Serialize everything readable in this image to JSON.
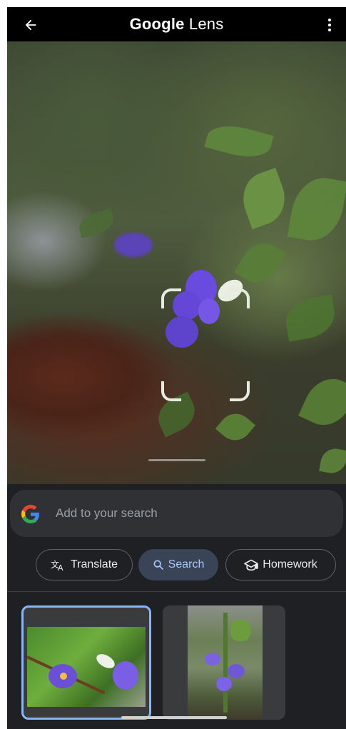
{
  "header": {
    "back_icon": "arrow-left-icon",
    "title_brand": "Google",
    "title_product": "Lens",
    "more_icon": "more-vertical-icon"
  },
  "viewer": {
    "selection": "flower-selection"
  },
  "search": {
    "logo_icon": "google-g-icon",
    "placeholder": "Add to your search"
  },
  "chips": [
    {
      "label": "Translate",
      "icon": "translate-icon",
      "active": false
    },
    {
      "label": "Search",
      "icon": "search-icon",
      "active": true
    },
    {
      "label": "Homework",
      "icon": "graduation-cap-icon",
      "active": false
    }
  ],
  "colors": {
    "accent": "#8ab4f8",
    "active_chip_bg": "#394457",
    "panel_bg": "#1f2023"
  }
}
